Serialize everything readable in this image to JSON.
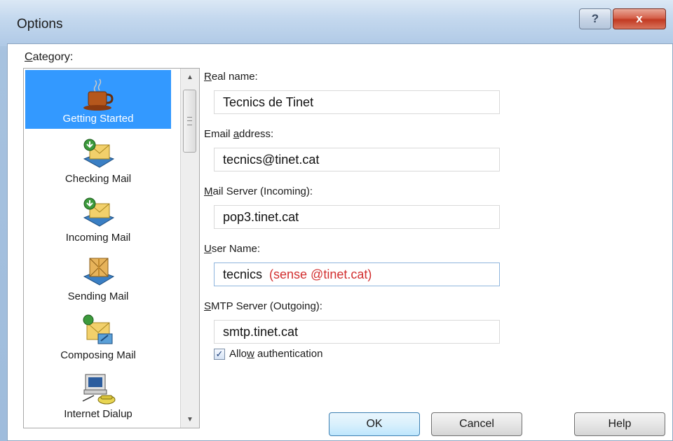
{
  "window": {
    "title": "Options",
    "help_glyph": "?",
    "close_glyph": "x"
  },
  "category": {
    "label_first": "C",
    "label_rest": "ategory:",
    "items": [
      {
        "label": "Getting Started",
        "icon": "coffee-cup-icon",
        "selected": true
      },
      {
        "label": "Checking Mail",
        "icon": "mail-check-icon",
        "selected": false
      },
      {
        "label": "Incoming Mail",
        "icon": "mail-incoming-icon",
        "selected": false
      },
      {
        "label": "Sending Mail",
        "icon": "mail-package-icon",
        "selected": false
      },
      {
        "label": "Composing Mail",
        "icon": "compose-mail-icon",
        "selected": false
      },
      {
        "label": "Internet Dialup",
        "icon": "computer-phone-icon",
        "selected": false
      }
    ]
  },
  "form": {
    "real_name": {
      "label_first": "R",
      "label_rest": "eal name:",
      "value": "Tecnics de Tinet"
    },
    "email": {
      "label_pre": "Email ",
      "label_u": "a",
      "label_rest": "ddress:",
      "value": "tecnics@tinet.cat"
    },
    "incoming": {
      "label_first": "M",
      "label_rest": "ail Server (Incoming):",
      "value": "pop3.tinet.cat"
    },
    "username": {
      "label_first": "U",
      "label_rest": "ser Name:",
      "value": "tecnics",
      "hint": "(sense @tinet.cat)"
    },
    "smtp": {
      "label_first": "S",
      "label_rest": "MTP Server (Outgoing):",
      "value": "smtp.tinet.cat"
    },
    "allow_auth": {
      "label_pre": "Allo",
      "label_u": "w",
      "label_rest": " authentication",
      "checked": true,
      "check_glyph": "✓"
    }
  },
  "buttons": {
    "ok": "OK",
    "cancel": "Cancel",
    "help": "Help"
  },
  "colors": {
    "selection": "#3399ff",
    "hint_red": "#d22f2f"
  }
}
